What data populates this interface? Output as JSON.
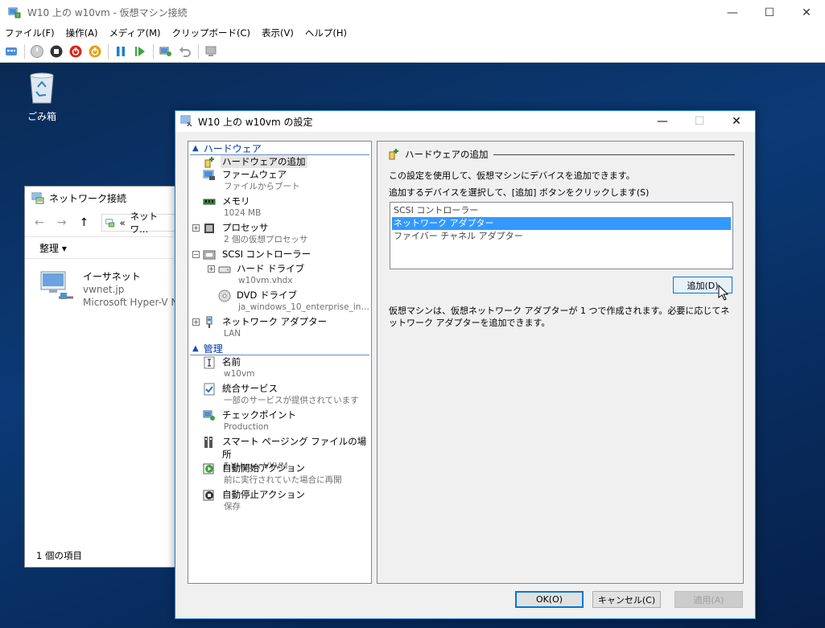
{
  "window": {
    "title": "W10 上の w10vm - 仮想マシン接続",
    "controls": {
      "minimize": "—",
      "maximize": "☐",
      "close": "✕"
    }
  },
  "menu": [
    "ファイル(F)",
    "操作(A)",
    "メディア(M)",
    "クリップボード(C)",
    "表示(V)",
    "ヘルプ(H)"
  ],
  "desktop": {
    "recycle_bin_label": "ごみ箱"
  },
  "explorer": {
    "title": "ネットワーク接続",
    "address_prefix": "«",
    "address": "ネットワ...",
    "organize": "整理 ▾",
    "item": {
      "name": "イーサネット",
      "network": "vwnet.jp",
      "adapter": "Microsoft Hyper-V Ne"
    },
    "status": "1 個の項目"
  },
  "dialog": {
    "title": "W10 上の w10vm の設定",
    "controls": {
      "minimize": "—",
      "maximize": "☐",
      "close": "✕"
    },
    "tree": {
      "hardware_header": "ハードウェア",
      "add_hardware": "ハードウェアの追加",
      "firmware": {
        "label": "ファームウェア",
        "sub": "ファイルからブート"
      },
      "memory": {
        "label": "メモリ",
        "sub": "1024 MB"
      },
      "processor": {
        "label": "プロセッサ",
        "sub": "2 個の仮想プロセッサ"
      },
      "scsi": {
        "label": "SCSI コントローラー"
      },
      "hdd": {
        "label": "ハード ドライブ",
        "sub": "w10vm.vhdx"
      },
      "dvd": {
        "label": "DVD ドライブ",
        "sub": "ja_windows_10_enterprise_ins..."
      },
      "netadapter": {
        "label": "ネットワーク アダプター",
        "sub": "LAN"
      },
      "management_header": "管理",
      "name": {
        "label": "名前",
        "sub": "w10vm"
      },
      "integration": {
        "label": "統合サービス",
        "sub": "一部のサービスが提供されています"
      },
      "checkpoint": {
        "label": "チェックポイント",
        "sub": "Production"
      },
      "paging": {
        "label": "スマート ページング ファイルの場所",
        "sub": "F:¥Hyper-V¥VM"
      },
      "autostart": {
        "label": "自動開始アクション",
        "sub": "前に実行されていた場合に再開"
      },
      "autostop": {
        "label": "自動停止アクション",
        "sub": "保存"
      }
    },
    "panel": {
      "heading": "ハードウェアの追加",
      "description": "この設定を使用して、仮想マシンにデバイスを追加できます。",
      "prompt": "追加するデバイスを選択して、[追加] ボタンをクリックします(S)",
      "devices": [
        "SCSI コントローラー",
        "ネットワーク アダプター",
        "ファイバー チャネル アダプター"
      ],
      "selected_device": "ネットワーク アダプター",
      "add_button": "追加(D)",
      "note": "仮想マシンは、仮想ネットワーク アダプターが 1 つで作成されます。必要に応じてネットワーク アダプターを追加できます。"
    },
    "buttons": {
      "ok": "OK(O)",
      "cancel": "キャンセル(C)",
      "apply": "適用(A)"
    }
  }
}
